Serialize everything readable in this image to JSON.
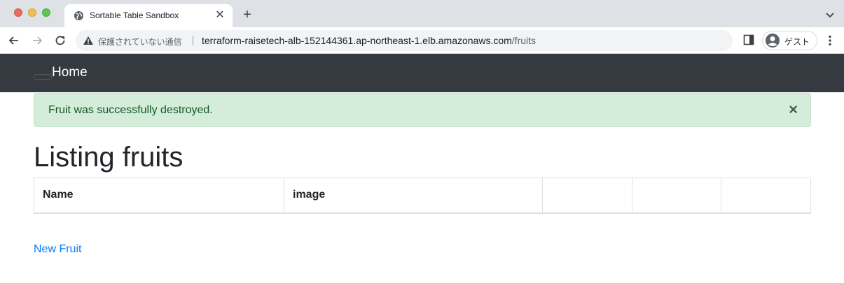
{
  "browser": {
    "tab_title": "Sortable Table Sandbox",
    "tab_close": "✕",
    "new_tab": "+",
    "security_label": "保護されていない通信",
    "url_host": "terraform-raisetech-alb-152144361.ap-northeast-1.elb.amazonaws.com",
    "url_path": "/fruits",
    "profile_label": "ゲスト"
  },
  "navbar": {
    "brand": "Home"
  },
  "alert": {
    "message": "Fruit was successfully destroyed.",
    "close": "×"
  },
  "page": {
    "title": "Listing fruits",
    "table": {
      "headers": [
        "Name",
        "image",
        "",
        "",
        ""
      ]
    },
    "new_link": "New Fruit"
  },
  "colors": {
    "navbar_bg": "#343a40",
    "alert_bg": "#d4edda",
    "alert_text": "#155724",
    "link": "#007bff"
  }
}
